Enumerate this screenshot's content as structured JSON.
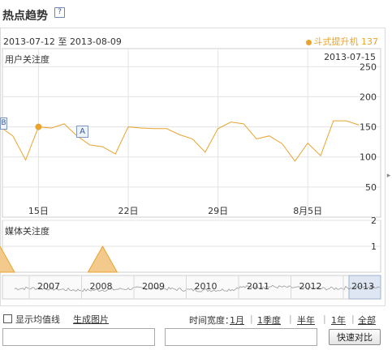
{
  "header": {
    "title": "热点趋势",
    "help_icon": "question-mark-icon"
  },
  "range": {
    "start": "2013-07-12",
    "sep": "至",
    "end": "2013-08-09"
  },
  "legend": {
    "name": "斗式提升机",
    "value": "137",
    "color": "#e8a42f"
  },
  "panels": {
    "user": "用户关注度",
    "media": "媒体关注度"
  },
  "current_date": "2013-07-15",
  "markers": {
    "left_cut": "B",
    "a_marker": "A"
  },
  "chart_data": [
    {
      "type": "line",
      "title": "用户关注度",
      "x": [
        "2013-07-12",
        "2013-07-13",
        "2013-07-14",
        "2013-07-15",
        "2013-07-16",
        "2013-07-17",
        "2013-07-18",
        "2013-07-19",
        "2013-07-20",
        "2013-07-21",
        "2013-07-22",
        "2013-07-23",
        "2013-07-24",
        "2013-07-25",
        "2013-07-26",
        "2013-07-27",
        "2013-07-28",
        "2013-07-29",
        "2013-07-30",
        "2013-07-31",
        "2013-08-01",
        "2013-08-02",
        "2013-08-03",
        "2013-08-04",
        "2013-08-05",
        "2013-08-06",
        "2013-08-07",
        "2013-08-08",
        "2013-08-09"
      ],
      "series": [
        {
          "name": "斗式提升机",
          "values": [
            150,
            135,
            95,
            150,
            148,
            155,
            135,
            120,
            117,
            105,
            150,
            148,
            147,
            147,
            137,
            130,
            108,
            147,
            158,
            155,
            130,
            135,
            122,
            93,
            123,
            102,
            160,
            160,
            153
          ],
          "color": "#e8a42f"
        }
      ],
      "xticks": [
        "15日",
        "22日",
        "29日",
        "8月5日"
      ],
      "yticks": [
        50,
        100,
        150,
        200,
        250
      ],
      "ylim": [
        0,
        280
      ],
      "grid": true
    },
    {
      "type": "area",
      "title": "媒体关注度",
      "x": [
        "2013-07-12",
        "2013-07-13",
        "2013-07-14",
        "2013-07-15",
        "2013-07-16",
        "2013-07-17",
        "2013-07-18",
        "2013-07-19",
        "2013-07-20",
        "2013-07-21",
        "2013-07-22",
        "2013-07-23",
        "2013-07-24",
        "2013-07-25",
        "2013-07-26",
        "2013-07-27",
        "2013-07-28",
        "2013-07-29",
        "2013-07-30",
        "2013-07-31",
        "2013-08-01",
        "2013-08-02",
        "2013-08-03",
        "2013-08-04",
        "2013-08-05",
        "2013-08-06",
        "2013-08-07",
        "2013-08-08",
        "2013-08-09"
      ],
      "series": [
        {
          "name": "斗式提升机",
          "values": [
            1,
            0,
            0,
            0,
            0,
            0,
            0,
            0,
            1,
            0,
            0,
            0,
            0,
            0,
            0,
            0,
            0,
            0,
            0,
            0,
            0,
            0,
            0,
            0,
            0,
            0,
            0,
            0,
            0
          ],
          "color": "#f3c98c"
        }
      ],
      "yticks": [
        1,
        2
      ],
      "ylim": [
        0,
        2
      ]
    },
    {
      "type": "line",
      "title": "",
      "xticks": [
        "2007",
        "2008",
        "2009",
        "2010",
        "2011",
        "2012",
        "2013"
      ]
    }
  ],
  "controls": {
    "avg_line": "显示均值线",
    "gen_image": "生成图片",
    "time_width": "时间宽度：",
    "ranges": [
      "1月",
      "1季度",
      "半年",
      "1年",
      "全部"
    ],
    "compare_button": "快速对比"
  }
}
